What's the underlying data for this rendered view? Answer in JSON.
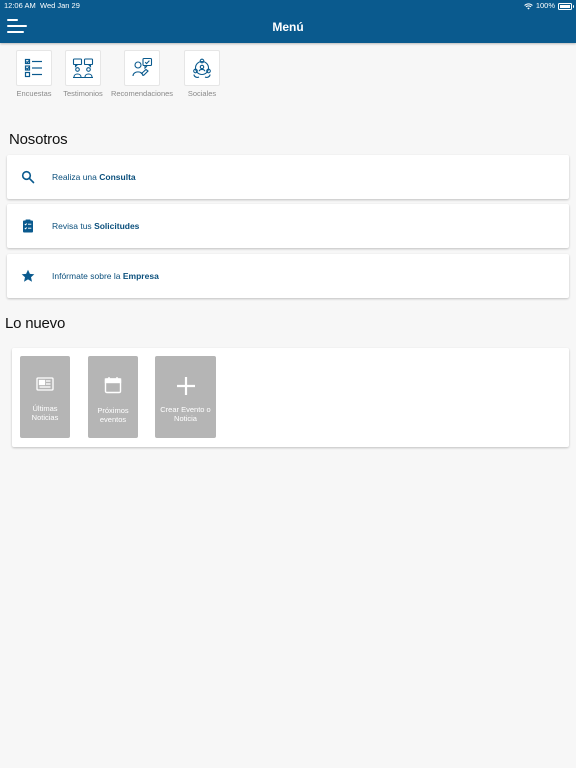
{
  "status_bar": {
    "time": "12:06 AM",
    "date": "Wed Jan 29",
    "battery": "100%"
  },
  "header": {
    "title": "Menú"
  },
  "quick_links": [
    {
      "label": "Encuestas",
      "icon": "checklist-icon"
    },
    {
      "label": "Testimonios",
      "icon": "people-chat-icon"
    },
    {
      "label": "Recomendaciones",
      "icon": "recommendation-icon"
    },
    {
      "label": "Sociales",
      "icon": "social-network-icon"
    }
  ],
  "nosotros": {
    "title": "Nosotros",
    "items": [
      {
        "prefix": "Realiza una",
        "bold": "Consulta",
        "icon": "search-icon"
      },
      {
        "prefix": "Revisa tus",
        "bold": "Solicitudes",
        "icon": "clipboard-list-icon"
      },
      {
        "prefix": "Infórmate sobre la",
        "bold": "Empresa",
        "icon": "star-icon"
      }
    ]
  },
  "lo_nuevo": {
    "title": "Lo nuevo",
    "tiles": [
      {
        "line1": "Últimas",
        "line2": "Noticias",
        "icon": "newspaper-icon"
      },
      {
        "line1": "Próximos",
        "line2": "eventos",
        "icon": "calendar-icon"
      },
      {
        "line1": "Crear Evento o",
        "line2": "Noticia",
        "icon": "plus-icon"
      }
    ]
  },
  "colors": {
    "primary": "#0a5a8e",
    "link_text": "#0a4f7c",
    "tile_gray": "#b5b5b5",
    "background": "#f7f7f7"
  }
}
